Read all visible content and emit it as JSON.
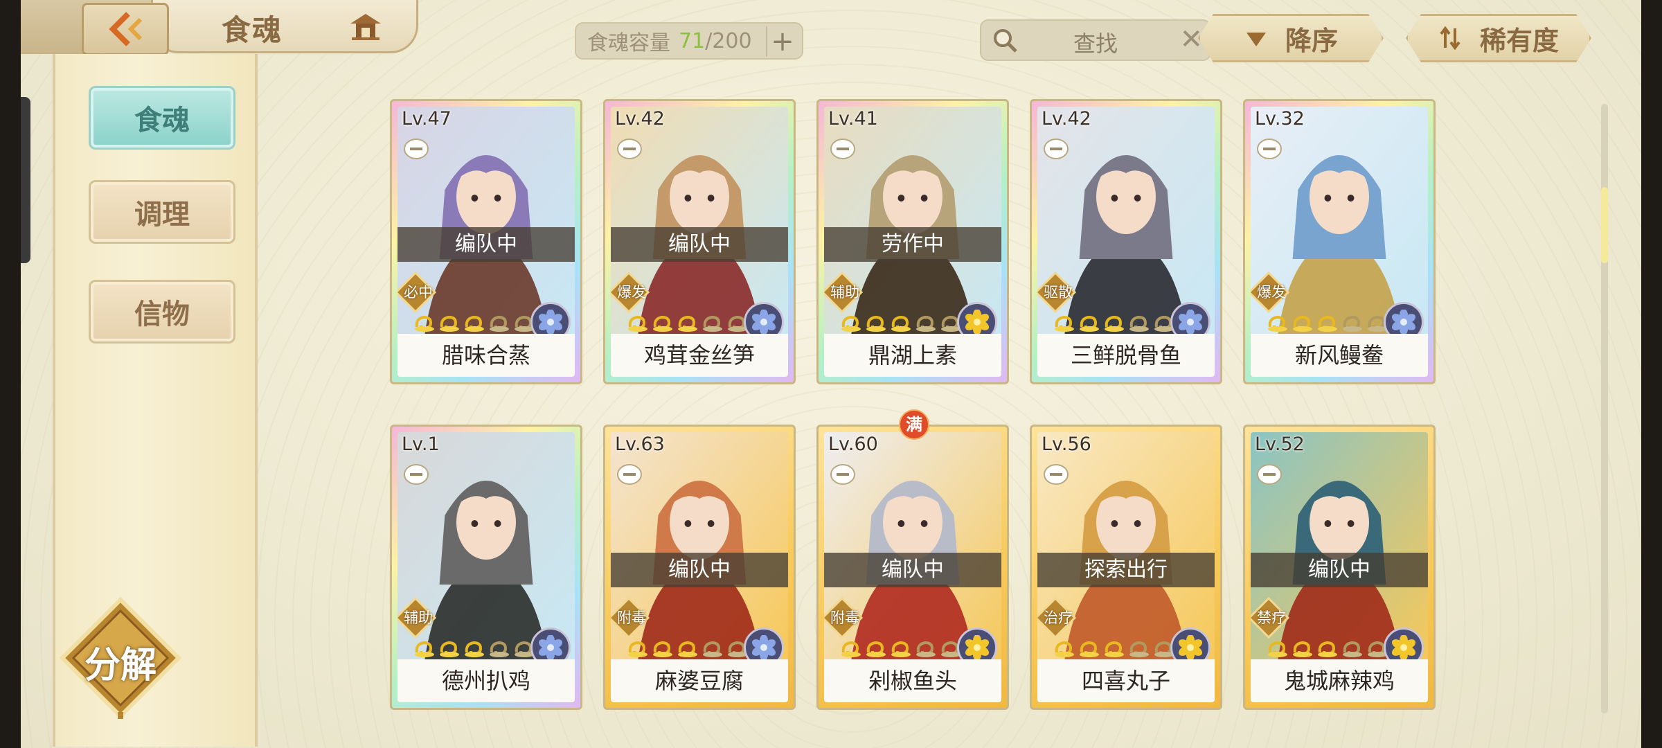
{
  "header": {
    "title": "食魂",
    "capacity_label": "食魂容量",
    "capacity_current": "71",
    "capacity_max": "/200",
    "capacity_add": "+",
    "search_placeholder": "查找",
    "search_clear": "✕",
    "sort_order_label": "降序",
    "sort_key_label": "稀有度"
  },
  "sidebar": {
    "items": [
      {
        "label": "食魂",
        "active": true
      },
      {
        "label": "调理",
        "active": false
      },
      {
        "label": "信物",
        "active": false
      }
    ],
    "decompose_label": "分解"
  },
  "cards": [
    {
      "level": "Lv.47",
      "name": "腊味合蒸",
      "status": "编队中",
      "role": "必中",
      "stars": 5,
      "element": "blue",
      "frame": "rainbow",
      "full": false
    },
    {
      "level": "Lv.42",
      "name": "鸡茸金丝笋",
      "status": "编队中",
      "role": "爆发",
      "stars": 5,
      "element": "blue",
      "frame": "rainbow",
      "full": false
    },
    {
      "level": "Lv.41",
      "name": "鼎湖上素",
      "status": "劳作中",
      "role": "辅助",
      "stars": 5,
      "element": "gold",
      "frame": "rainbow",
      "full": false
    },
    {
      "level": "Lv.42",
      "name": "三鲜脱骨鱼",
      "status": "",
      "role": "驱散",
      "stars": 5,
      "element": "blue",
      "frame": "rainbow",
      "full": false
    },
    {
      "level": "Lv.32",
      "name": "新风鳗鲞",
      "status": "",
      "role": "爆发",
      "stars": 5,
      "element": "blue",
      "frame": "rainbow",
      "full": false
    },
    {
      "level": "Lv.1",
      "name": "德州扒鸡",
      "status": "",
      "role": "辅助",
      "stars": 5,
      "element": "blue",
      "frame": "rainbow",
      "full": false
    },
    {
      "level": "Lv.63",
      "name": "麻婆豆腐",
      "status": "编队中",
      "role": "附毒",
      "stars": 5,
      "element": "blue",
      "frame": "gold",
      "full": false
    },
    {
      "level": "Lv.60",
      "name": "剁椒鱼头",
      "status": "编队中",
      "role": "附毒",
      "stars": 5,
      "element": "gold",
      "frame": "gold",
      "full": true,
      "full_label": "满"
    },
    {
      "level": "Lv.56",
      "name": "四喜丸子",
      "status": "探索出行",
      "role": "治疗",
      "stars": 5,
      "element": "gold",
      "frame": "gold",
      "full": false
    },
    {
      "level": "Lv.52",
      "name": "鬼城麻辣鸡",
      "status": "编队中",
      "role": "禁疗",
      "stars": 5,
      "element": "gold",
      "frame": "gold",
      "full": false
    }
  ],
  "colors": {
    "accent_teal": "#8ad2ca",
    "capacity_green": "#8cc040",
    "status_band": "#463e32",
    "role_gold": "#b8862e"
  }
}
